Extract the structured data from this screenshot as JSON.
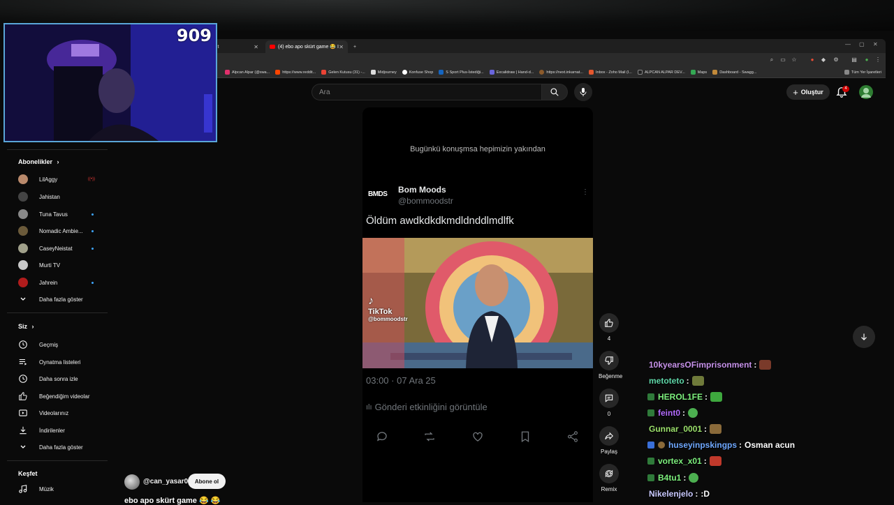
{
  "webcam": {
    "viewer_count": "909"
  },
  "browser": {
    "tabs": [
      {
        "label": "nit"
      },
      {
        "label": "(4) ebo apo skürt game 😂 I"
      }
    ],
    "bookmarks": [
      "Alpcan Alpar (@swa...",
      "https://www.reddit...",
      "Gelen Kutusu (31) -...",
      "Midjourney",
      "Konfuse Shop",
      "S Sport Plus-İstediği...",
      "Excalidraw | Hand-d...",
      "https://next.inkarnat...",
      "Inbox - Zoho Mail (I...",
      "ALPCAN ALPAR DEV...",
      "Maps",
      "Dashboard - Swagg...",
      "Tüm Yer İşaretleri"
    ]
  },
  "header": {
    "search_placeholder": "Ara",
    "create_label": "Oluştur",
    "notification_count": "4"
  },
  "sidebar": {
    "subscriptions_title": "Abonelikler",
    "subscriptions": [
      {
        "name": "LilAggy",
        "status": "live",
        "color": "#b9896b"
      },
      {
        "name": "Jahistan",
        "status": "",
        "color": "#444444"
      },
      {
        "name": "Tuna Tavus",
        "status": "new",
        "color": "#888888"
      },
      {
        "name": "Nomadic Ambie...",
        "status": "new",
        "color": "#6b5a3a"
      },
      {
        "name": "CaseyNeistat",
        "status": "new",
        "color": "#a0a08a"
      },
      {
        "name": "Murti TV",
        "status": "",
        "color": "#c8c8c8"
      },
      {
        "name": "Jahrein",
        "status": "new",
        "color": "#b01c1c"
      }
    ],
    "show_more_subs": "Daha fazla göster",
    "you_title": "Siz",
    "you_items": [
      {
        "label": "Geçmiş",
        "icon": "history-icon"
      },
      {
        "label": "Oynatma listeleri",
        "icon": "playlist-icon"
      },
      {
        "label": "Daha sonra izle",
        "icon": "clock-icon"
      },
      {
        "label": "Beğendiğim videolar",
        "icon": "thumbs-up-icon"
      },
      {
        "label": "Videolarınız",
        "icon": "video-icon"
      },
      {
        "label": "İndirilenler",
        "icon": "download-icon"
      }
    ],
    "show_more_you": "Daha fazla göster",
    "explore_title": "Keşfet",
    "explore_items": [
      {
        "label": "Müzik",
        "icon": "music-icon"
      }
    ]
  },
  "short": {
    "caption": "Bugünkü konuşmsa hepimizin yakından",
    "logo_text": "BMDS",
    "author": "Bom Moods",
    "handle": "@bommoodstr",
    "tweet_text": "Öldüm awdkdkdkmdldnddlmdlfk",
    "video_watermark": "TikTok",
    "video_watermark_handle": "@bommoodstr",
    "timestamp": "03:00 · 07 Ara 25",
    "activity_label": "Gönderi etkinliğini görüntüle",
    "channel_handle": "@can_yasar0",
    "subscribe_label": "Abone ol",
    "title": "ebo apo skürt game 😂 😂"
  },
  "actions": {
    "like_count": "4",
    "dislike_label": "Beğenme",
    "comment_count": "0",
    "share_label": "Paylaş",
    "remix_label": "Remix"
  },
  "chat": [
    {
      "user": "10kyearsOFimprisonment",
      "color": "#c792ea",
      "badge": "",
      "message": "",
      "emote_color": "#7a3a2a"
    },
    {
      "user": "metoteto",
      "color": "#5fd7a8",
      "badge": "",
      "message": "",
      "emote_color": "#6f7a3a"
    },
    {
      "user": "HEROL1FE",
      "color": "#7df07d",
      "badge": "#2f7a3a",
      "message": "",
      "emote_color": "#3ea83e"
    },
    {
      "user": "feint0",
      "color": "#b46cff",
      "badge": "#2f7a3a",
      "message": "",
      "emote_color": "#4caf50"
    },
    {
      "user": "Gunnar_0001",
      "color": "#9be06b",
      "badge": "",
      "message": "",
      "emote_color": "#8a6a3a"
    },
    {
      "user": "huseyinpskingps",
      "color": "#6fa8ff",
      "badge": "#3a6fd8",
      "message": "Osman acun",
      "emote_color": ""
    },
    {
      "user": "vortex_x01",
      "color": "#7df07d",
      "badge": "#2f7a3a",
      "message": "",
      "emote_color": "#c0392b"
    },
    {
      "user": "B4tu1",
      "color": "#7df07d",
      "badge": "#2f7a3a",
      "message": "",
      "emote_color": "#4caf50"
    },
    {
      "user": "Nikelenjelo",
      "color": "#c9c9ff",
      "badge": "",
      "message": ":D",
      "emote_color": ""
    }
  ]
}
